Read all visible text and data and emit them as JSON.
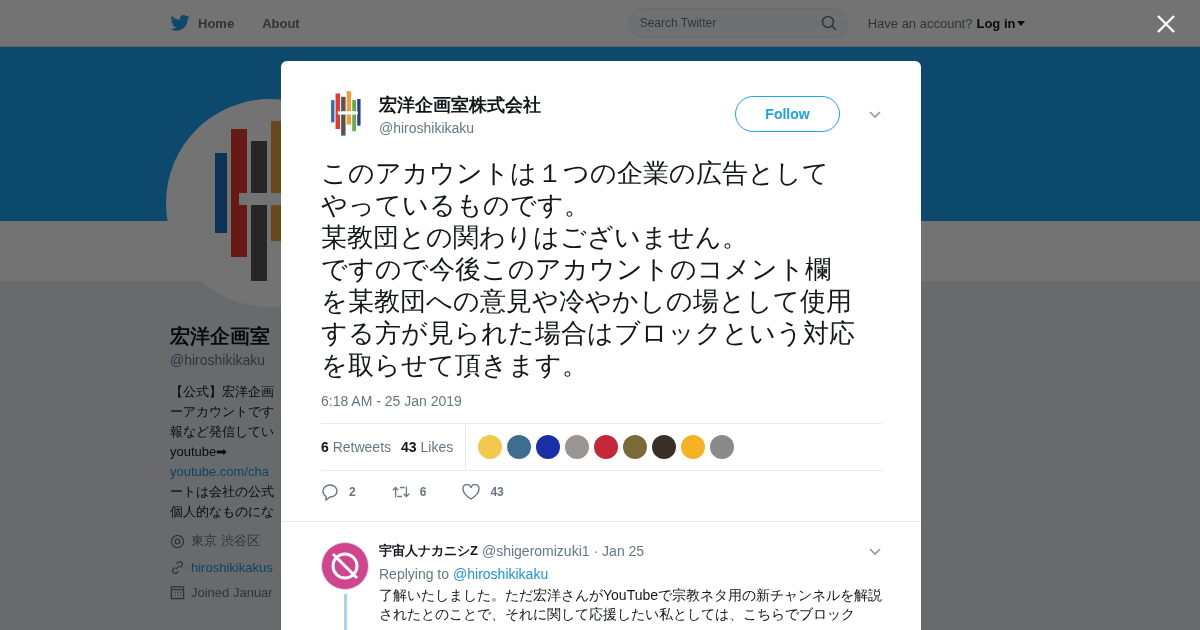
{
  "nav": {
    "home": "Home",
    "about": "About",
    "search_placeholder": "Search Twitter",
    "account_prompt": "Have an account?",
    "login": "Log in"
  },
  "profile": {
    "name": "宏洋企画室",
    "handle": "@hiroshikikaku",
    "bio": [
      {
        "kind": "text",
        "text": "【公式】宏洋企画"
      },
      {
        "kind": "text",
        "text": "ーアカウントです"
      },
      {
        "kind": "text",
        "text": "報など発信してい"
      },
      {
        "kind": "text",
        "text": "youtube➡"
      },
      {
        "kind": "link",
        "text": "youtube.com/cha"
      },
      {
        "kind": "text",
        "text": "ートは会社の公式"
      },
      {
        "kind": "text",
        "text": "個人的なものにな"
      }
    ],
    "location": "東京 渋谷区",
    "website": "hiroshikikakus",
    "joined": "Joined Januar"
  },
  "tweet": {
    "name": "宏洋企画室株式会社",
    "handle": "@hiroshikikaku",
    "follow": "Follow",
    "lines": [
      "このアカウントは１つの企業の広告として",
      "やっているものです。",
      "某教団との関わりはございません。",
      "ですので今後このアカウントのコメント欄",
      "を某教団への意見や冷やかしの場として使用",
      "する方が見られた場合はブロックという対応",
      "を取らせて頂きます。"
    ],
    "time": "6:18 AM - 25 Jan 2019",
    "retweets": {
      "count": "6",
      "label": "Retweets"
    },
    "likes": {
      "count": "43",
      "label": "Likes"
    },
    "likers": [
      {
        "color": "#f2c94c"
      },
      {
        "color": "#3d6e8f"
      },
      {
        "color": "#1b2fa8"
      },
      {
        "color": "#9a9590"
      },
      {
        "color": "#c2283a"
      },
      {
        "color": "#7a6a3a"
      },
      {
        "color": "#3a3028"
      },
      {
        "color": "#f5b324"
      },
      {
        "color": "#8a8a8a"
      }
    ],
    "actions": {
      "replies": "2",
      "retweets": "6",
      "likes": "43"
    }
  },
  "reply": {
    "name": "宇宙人ナカニシZ",
    "handle": "@shigeromizuki1",
    "date": "· Jan 25",
    "replying_label": "Replying to",
    "replying_to": "@hiroshikikaku",
    "text": "了解いたしました。ただ宏洋さんがYouTubeで宗教ネタ用の新チャンネルを解説されたとのことで、それに関して応援したい私としては、こちらでブロック"
  }
}
